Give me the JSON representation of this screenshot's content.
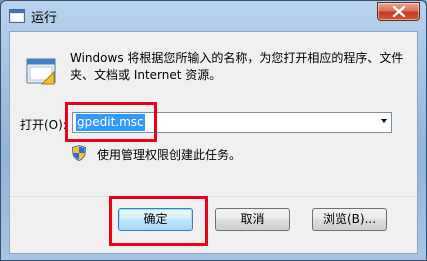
{
  "window": {
    "title": "运行"
  },
  "body": {
    "description": "Windows 将根据您所输入的名称，为您打开相应的程序、文件夹、文档或 Internet 资源。",
    "open_label": "打开(O):",
    "open_value": "gpedit.msc",
    "admin_note": "使用管理权限创建此任务。"
  },
  "buttons": {
    "ok": "确定",
    "cancel": "取消",
    "browse": "浏览(B)..."
  },
  "colors": {
    "highlight_box": "#e8001c",
    "selection": "#3399ff"
  },
  "icons": {
    "title": "run-icon",
    "close": "close-icon",
    "app": "run-program-icon",
    "shield": "uac-shield-icon"
  }
}
